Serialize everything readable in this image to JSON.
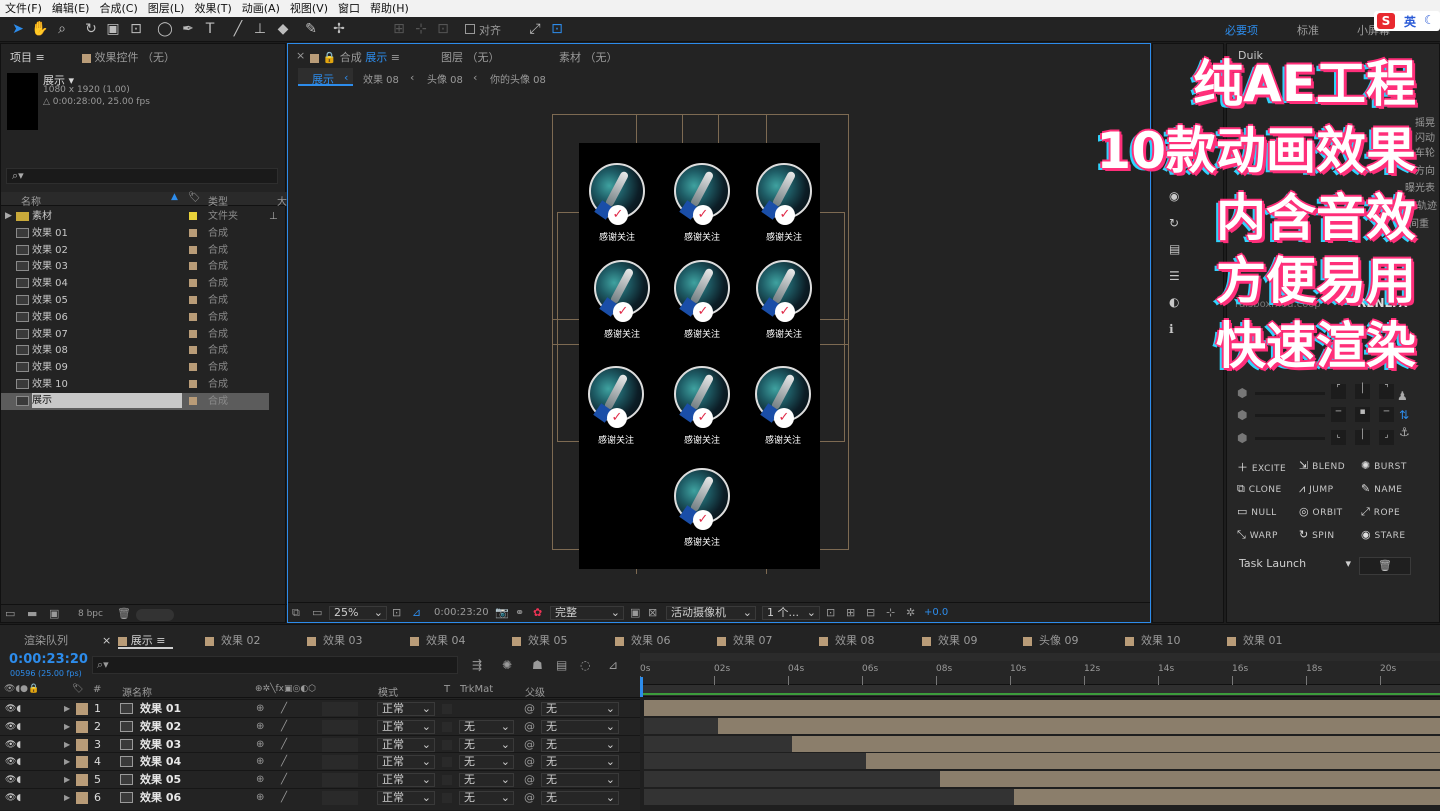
{
  "menu": [
    "文件(F)",
    "编辑(E)",
    "合成(C)",
    "图层(L)",
    "效果(T)",
    "动画(A)",
    "视图(V)",
    "窗口",
    "帮助(H)"
  ],
  "toolbar": {
    "snap_label": "对齐",
    "workspaces": [
      "必要项",
      "标准",
      "小屏幕"
    ],
    "ime": "英"
  },
  "project": {
    "tab": "项目",
    "effects_tab": "效果控件 （无）",
    "comp_name": "展示 ▾",
    "comp_size": "1080 x 1920 (1.00)",
    "comp_dur": "△ 0:00:28:00, 25.00 fps",
    "col_name": "名称",
    "col_type": "类型",
    "col_size": "大",
    "items": [
      {
        "name": "素材",
        "type": "文件夹"
      },
      {
        "name": "效果 01",
        "type": "合成"
      },
      {
        "name": "效果 02",
        "type": "合成"
      },
      {
        "name": "效果 03",
        "type": "合成"
      },
      {
        "name": "效果 04",
        "type": "合成"
      },
      {
        "name": "效果 05",
        "type": "合成"
      },
      {
        "name": "效果 06",
        "type": "合成"
      },
      {
        "name": "效果 07",
        "type": "合成"
      },
      {
        "name": "效果 08",
        "type": "合成"
      },
      {
        "name": "效果 09",
        "type": "合成"
      },
      {
        "name": "效果 10",
        "type": "合成"
      },
      {
        "name": "展示",
        "type": "合成"
      }
    ],
    "bpc": "8 bpc"
  },
  "viewer": {
    "tab_comp": "合成",
    "tab_comp_name": "展示",
    "tab_layer": "图层 （无）",
    "tab_footage": "素材 （无）",
    "crumbs": [
      "展示",
      "效果 08",
      "头像 08",
      "你的头像 08"
    ],
    "avatar_label": "感谢关注",
    "zoom": "25%",
    "timecode": "0:00:23:20",
    "quality": "完整",
    "camera": "活动摄像机",
    "views": "1 个...",
    "exposure": "+0.0"
  },
  "overlay": [
    "纯AE工程",
    "10款动画效果",
    "内含音效",
    "方便易用",
    "快速渲染"
  ],
  "duik": {
    "title": "Duik",
    "side_labels": [
      "摇晃",
      "闪动",
      "车轮",
      "方向",
      "曝光表",
      "运动轨迹",
      "时间重"
    ],
    "watermark": "raisboxmod.coop",
    "fx": "RENLTX",
    "buttons": [
      "EXCITE",
      "BLEND",
      "BURST",
      "CLONE",
      "JUMP",
      "NAME",
      "NULL",
      "ORBIT",
      "ROPE",
      "WARP",
      "SPIN",
      "STARE"
    ],
    "task": "Task Launch"
  },
  "timeline": {
    "tabs": [
      "渲染队列",
      "展示",
      "效果 02",
      "效果 03",
      "效果 04",
      "效果 05",
      "效果 06",
      "效果 07",
      "效果 08",
      "效果 09",
      "头像 09",
      "效果 10",
      "效果 01"
    ],
    "time": "0:00:23:20",
    "frames": "00596 (25.00 fps)",
    "cols": {
      "num": "#",
      "src": "源名称",
      "mode": "模式",
      "t": "T",
      "trk": "TrkMat",
      "parent": "父级"
    },
    "ruler": [
      "0s",
      "02s",
      "04s",
      "06s",
      "08s",
      "10s",
      "12s",
      "14s",
      "16s",
      "18s",
      "20s"
    ],
    "layers": [
      {
        "n": "1",
        "name": "效果 01",
        "mode": "正常",
        "trk": "",
        "parent": "无",
        "start": 0
      },
      {
        "n": "2",
        "name": "效果 02",
        "mode": "正常",
        "trk": "无",
        "parent": "无",
        "start": 2
      },
      {
        "n": "3",
        "name": "效果 03",
        "mode": "正常",
        "trk": "无",
        "parent": "无",
        "start": 4
      },
      {
        "n": "4",
        "name": "效果 04",
        "mode": "正常",
        "trk": "无",
        "parent": "无",
        "start": 6
      },
      {
        "n": "5",
        "name": "效果 05",
        "mode": "正常",
        "trk": "无",
        "parent": "无",
        "start": 8
      },
      {
        "n": "6",
        "name": "效果 06",
        "mode": "正常",
        "trk": "无",
        "parent": "无",
        "start": 10
      }
    ]
  },
  "colors": {
    "accent": "#2d8ceb",
    "label": "#b99c78",
    "overlay_pink": "#ff2f7a",
    "overlay_cyan": "#2fd4ff"
  }
}
